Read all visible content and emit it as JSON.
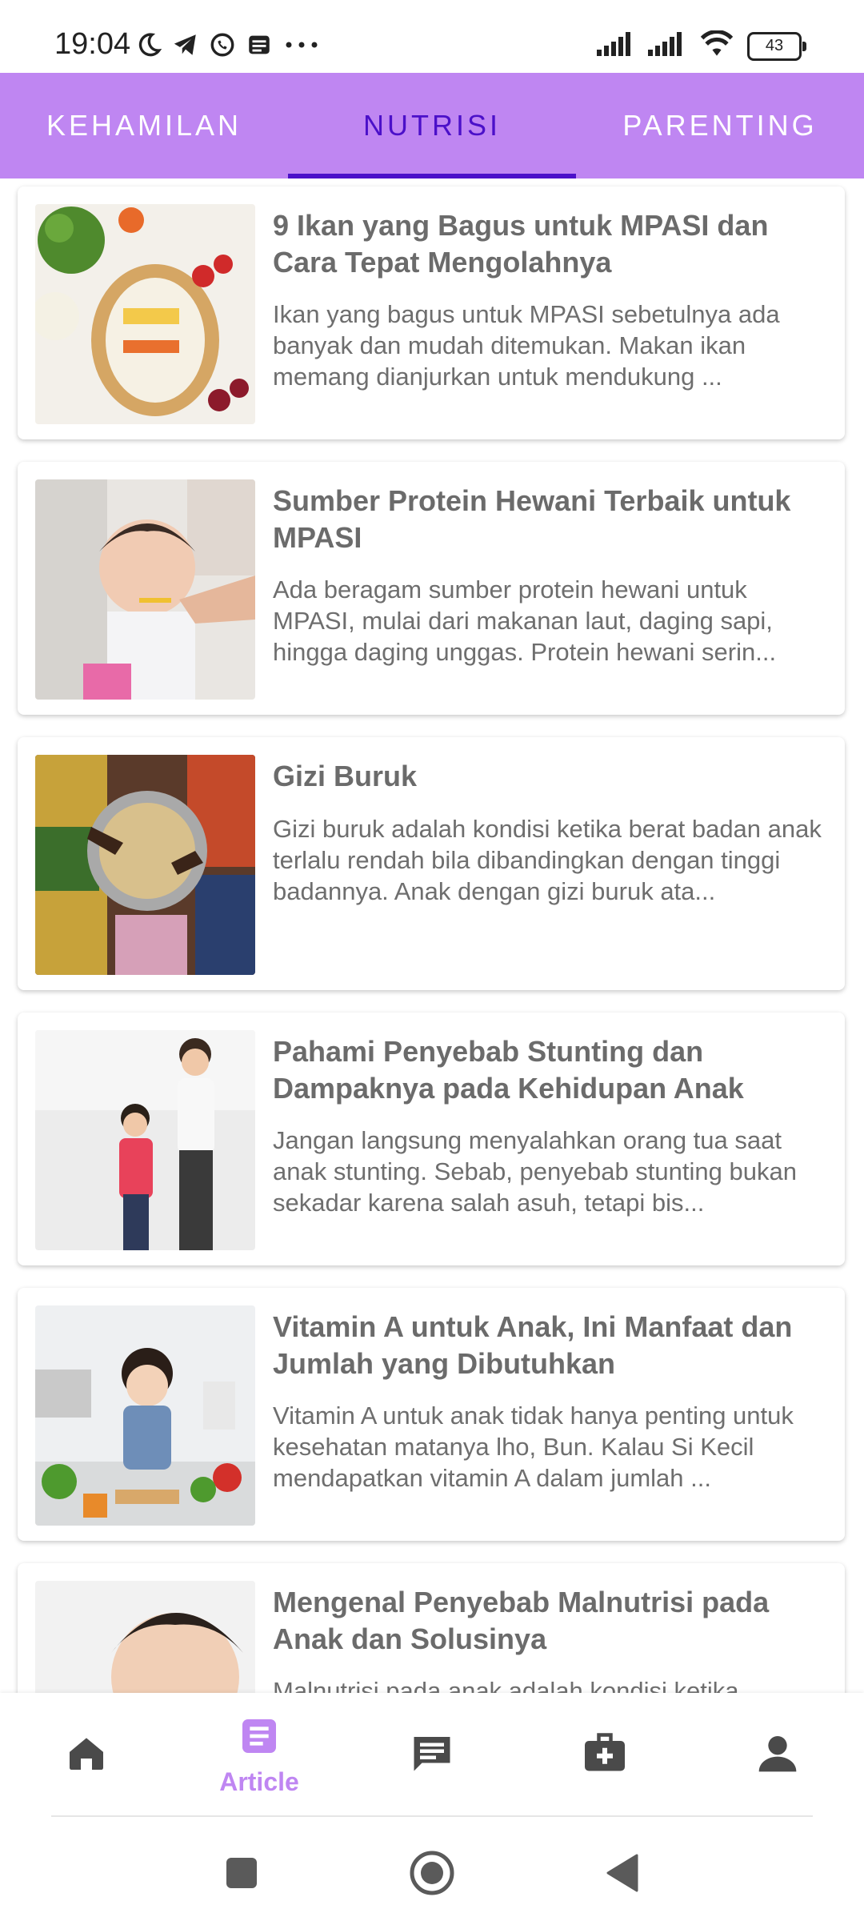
{
  "status_bar": {
    "time": "19:04",
    "battery": "43",
    "icons": [
      "moon-icon",
      "telegram-icon",
      "whatsapp-icon",
      "notes-icon",
      "more-icon",
      "signal-icon",
      "signal-icon",
      "wifi-icon",
      "battery-icon"
    ]
  },
  "tabs": [
    {
      "label": "KEHAMILAN",
      "active": false
    },
    {
      "label": "NUTRISI",
      "active": true
    },
    {
      "label": "PARENTING",
      "active": false
    }
  ],
  "articles": [
    {
      "title": "9 Ikan yang Bagus untuk MPASI dan Cara Tepat Mengolahnya",
      "description": "Ikan yang bagus untuk MPASI sebetulnya ada banyak dan mudah ditemukan. Makan ikan memang dianjurkan untuk mendukung ..."
    },
    {
      "title": "Sumber Protein Hewani Terbaik untuk MPASI",
      "description": "Ada beragam sumber protein hewani untuk MPASI, mulai dari makanan laut, daging sapi, hingga daging unggas. Protein hewani serin..."
    },
    {
      "title": "Gizi Buruk",
      "description": "Gizi buruk adalah kondisi ketika berat badan anak terlalu rendah bila dibandingkan dengan tinggi badannya. Anak dengan gizi buruk ata..."
    },
    {
      "title": "Pahami Penyebab Stunting dan Dampaknya pada Kehidupan Anak",
      "description": "Jangan langsung menyalahkan orang tua saat anak stunting. Sebab, penyebab stunting bukan sekadar karena salah asuh, tetapi bis..."
    },
    {
      "title": "Vitamin A untuk Anak, Ini Manfaat dan Jumlah yang Dibutuhkan",
      "description": "Vitamin A untuk anak tidak hanya penting untuk kesehatan matanya lho, Bun. Kalau Si Kecil mendapatkan vitamin A dalam jumlah ..."
    },
    {
      "title": "Mengenal Penyebab Malnutrisi pada Anak dan Solusinya",
      "description": "Malnutrisi pada anak adalah kondisi ketika"
    }
  ],
  "bottom_nav": [
    {
      "icon": "home-icon",
      "label": ""
    },
    {
      "icon": "article-icon",
      "label": "Article"
    },
    {
      "icon": "chat-icon",
      "label": ""
    },
    {
      "icon": "medical-kit-icon",
      "label": ""
    },
    {
      "icon": "profile-icon",
      "label": ""
    }
  ],
  "colors": {
    "accent": "#bf86f2",
    "tab_active": "#4b10c9",
    "text_gray": "#6b6b6b",
    "icon_dark": "#4a4a4a"
  }
}
